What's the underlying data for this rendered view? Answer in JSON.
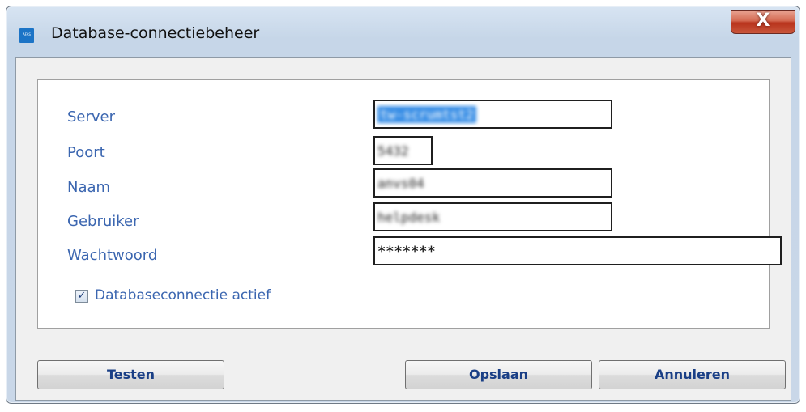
{
  "window": {
    "title": "Database-connectiebeheer",
    "close_label": "X",
    "app_icon_text": "AFAS"
  },
  "form": {
    "server": {
      "label": "Server",
      "value": "tw-scrumtst2"
    },
    "poort": {
      "label": "Poort",
      "value": "5432"
    },
    "naam": {
      "label": "Naam",
      "value": "anvs04"
    },
    "gebruiker": {
      "label": "Gebruiker",
      "value": "helpdesk"
    },
    "wachtwoord": {
      "label": "Wachtwoord",
      "value": "*******"
    },
    "active_checkbox": {
      "label": "Databaseconnectie actief",
      "checked": true,
      "mark": "✓"
    }
  },
  "buttons": {
    "testen": {
      "first": "T",
      "rest": "esten"
    },
    "opslaan": {
      "first": "O",
      "rest": "pslaan"
    },
    "annuleren": {
      "first": "A",
      "rest": "nnuleren"
    }
  }
}
